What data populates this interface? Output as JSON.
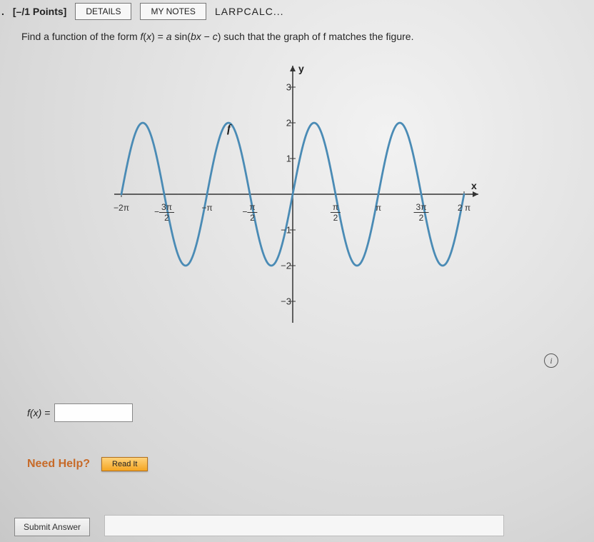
{
  "header": {
    "qnum": ".",
    "points": "[–/1 Points]",
    "details": "DETAILS",
    "notes": "MY NOTES",
    "source_cut": "LARPCALC..."
  },
  "prompt": {
    "pre": "Find a function of the form ",
    "formula": "f(x) = a sin(bx − c)",
    "post": " such that the graph of f matches the figure."
  },
  "chart_data": {
    "type": "line",
    "xlabel": "x",
    "ylabel": "y",
    "series_label": "f",
    "x_range_pi": [
      -2,
      2
    ],
    "y_range": [
      -3,
      3
    ],
    "y_ticks": [
      -3,
      -2,
      -1,
      1,
      2,
      3
    ],
    "x_ticks_pi": [
      {
        "v": -2,
        "label": "−2π"
      },
      {
        "v": -1.5,
        "label": "−3π/2"
      },
      {
        "v": -1,
        "label": "−π"
      },
      {
        "v": -0.5,
        "label": "−π/2"
      },
      {
        "v": 0.5,
        "label": "π/2"
      },
      {
        "v": 1,
        "label": "π"
      },
      {
        "v": 1.5,
        "label": "3π/2"
      },
      {
        "v": 2,
        "label": "2π"
      }
    ],
    "function": "2*sin(2*x)",
    "amplitude": 2,
    "b": 2,
    "c": 0,
    "period_pi": 1
  },
  "labels": {
    "y": "y",
    "x": "x",
    "f": "f",
    "y3": "3",
    "y2": "2",
    "y1": "1",
    "yn1": "−1",
    "yn2": "−2",
    "yn3": "−3",
    "xn2pi": "−2π",
    "xnpi": "−π",
    "xpi": "π",
    "x2pi": "2 π",
    "x3pi2_num": "3π",
    "xpi2_num": "π",
    "den2": "2",
    "neg": "−"
  },
  "answer": {
    "label": "f(x) =",
    "value": ""
  },
  "help": {
    "label": "Need Help?",
    "readit": "Read It"
  },
  "submit": {
    "label": "Submit Answer"
  },
  "info": "i"
}
